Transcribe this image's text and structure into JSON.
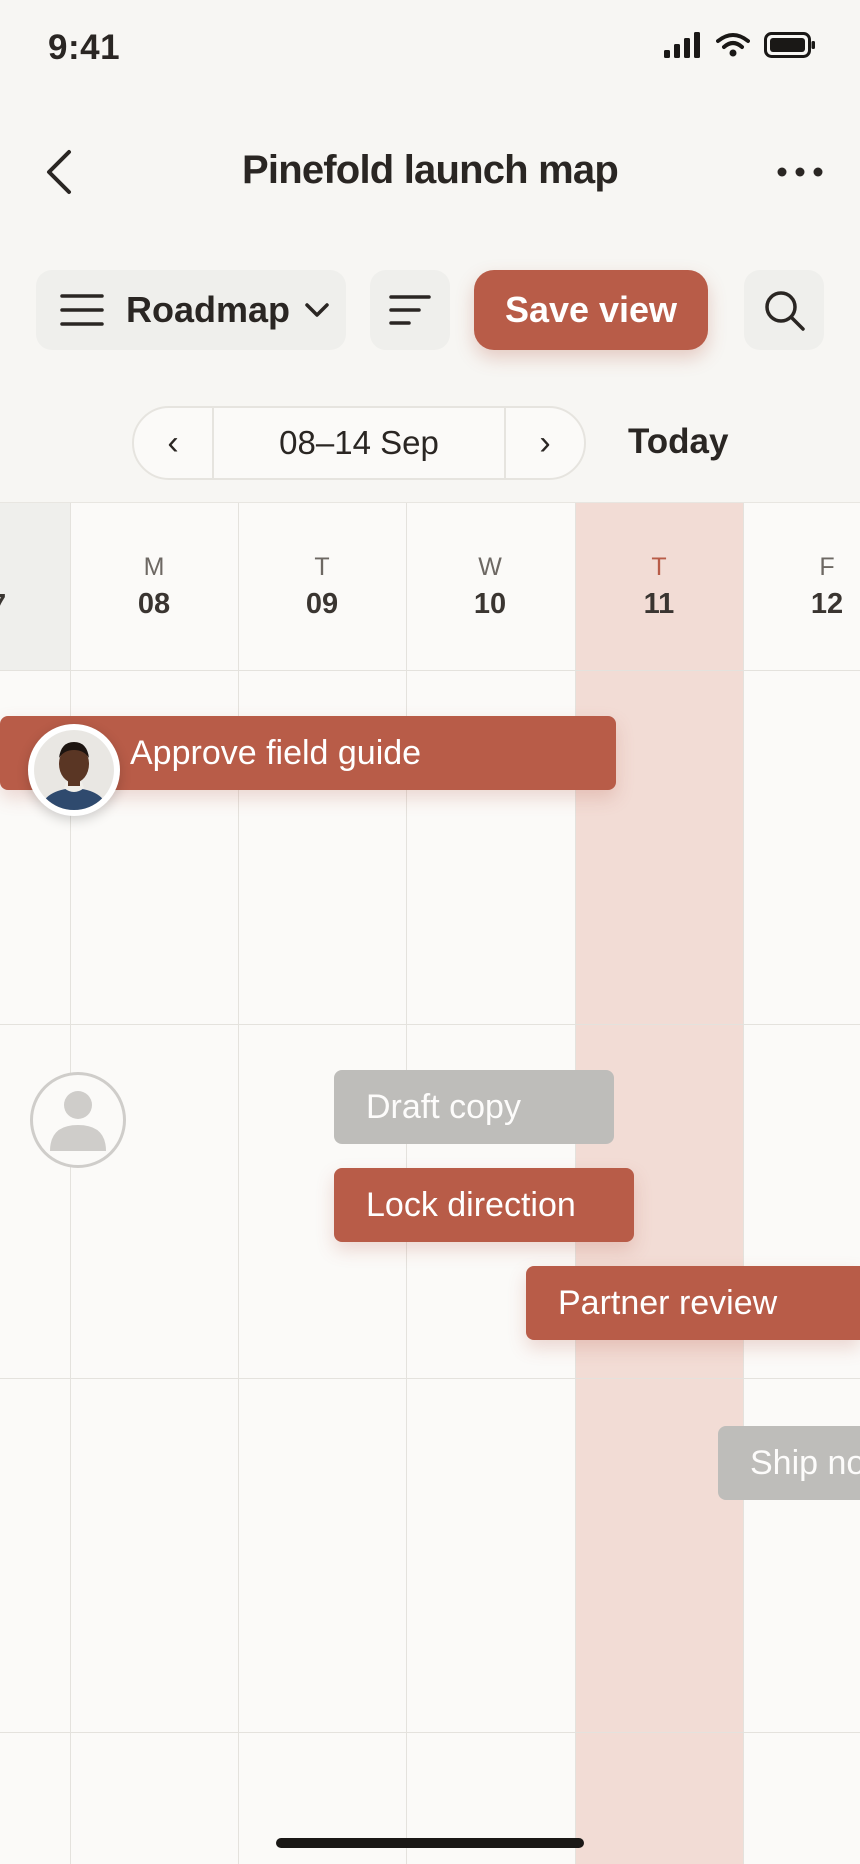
{
  "status_bar": {
    "time": "9:41"
  },
  "header": {
    "title": "Pinefold launch map"
  },
  "toolbar": {
    "view_label": "Roadmap",
    "save_label": "Save view"
  },
  "date_nav": {
    "prev": "‹",
    "range": "08–14 Sep",
    "next": "›",
    "today_label": "Today"
  },
  "days": [
    {
      "weekday": "M",
      "date": "08"
    },
    {
      "weekday": "T",
      "date": "09"
    },
    {
      "weekday": "W",
      "date": "10"
    },
    {
      "weekday": "T",
      "date": "11",
      "today": true
    },
    {
      "weekday": "F",
      "date": "12"
    }
  ],
  "prev_day_partial": "7",
  "tasks": [
    {
      "label": "Approve field guide",
      "status": "active"
    },
    {
      "label": "Draft copy",
      "status": "muted"
    },
    {
      "label": "Lock direction",
      "status": "active"
    },
    {
      "label": "Partner review",
      "status": "active"
    },
    {
      "label": "Ship notes",
      "status": "muted"
    }
  ],
  "colors": {
    "accent": "#b85c48",
    "today_column": "#f2dcd5",
    "muted_task": "#bebdba",
    "background": "#f7f6f3"
  }
}
